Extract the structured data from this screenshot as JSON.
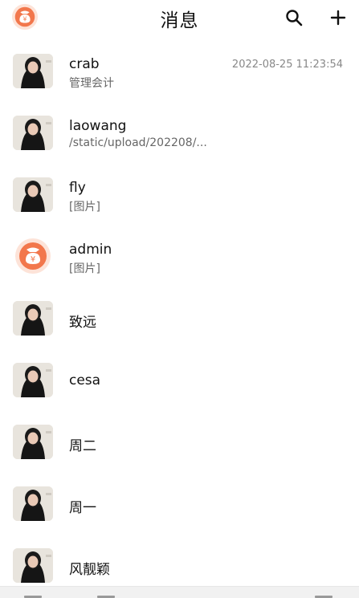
{
  "header": {
    "title": "消息",
    "logo_icon": "money-bag-icon",
    "search_icon": "search-icon",
    "add_icon": "plus-icon"
  },
  "colors": {
    "accent": "#f2774c",
    "text": "#111111",
    "subtext": "#666666",
    "time": "#888888"
  },
  "conversations": [
    {
      "name": "crab",
      "preview": "管理会计",
      "time": "2022-08-25 11:23:54",
      "avatar": "user-photo"
    },
    {
      "name": "laowang",
      "preview": "/static/upload/202208/...",
      "time": "",
      "avatar": "user-photo"
    },
    {
      "name": "fly",
      "preview": "[图片]",
      "time": "",
      "avatar": "user-photo"
    },
    {
      "name": "admin",
      "preview": "[图片]",
      "time": "",
      "avatar": "money-bag-logo"
    },
    {
      "name": "致远",
      "preview": "",
      "time": "",
      "avatar": "user-photo"
    },
    {
      "name": "cesa",
      "preview": "",
      "time": "",
      "avatar": "user-photo"
    },
    {
      "name": "周二",
      "preview": "",
      "time": "",
      "avatar": "user-photo"
    },
    {
      "name": "周一",
      "preview": "",
      "time": "",
      "avatar": "user-photo"
    },
    {
      "name": "风靓颖",
      "preview": "",
      "time": "",
      "avatar": "user-photo"
    }
  ]
}
